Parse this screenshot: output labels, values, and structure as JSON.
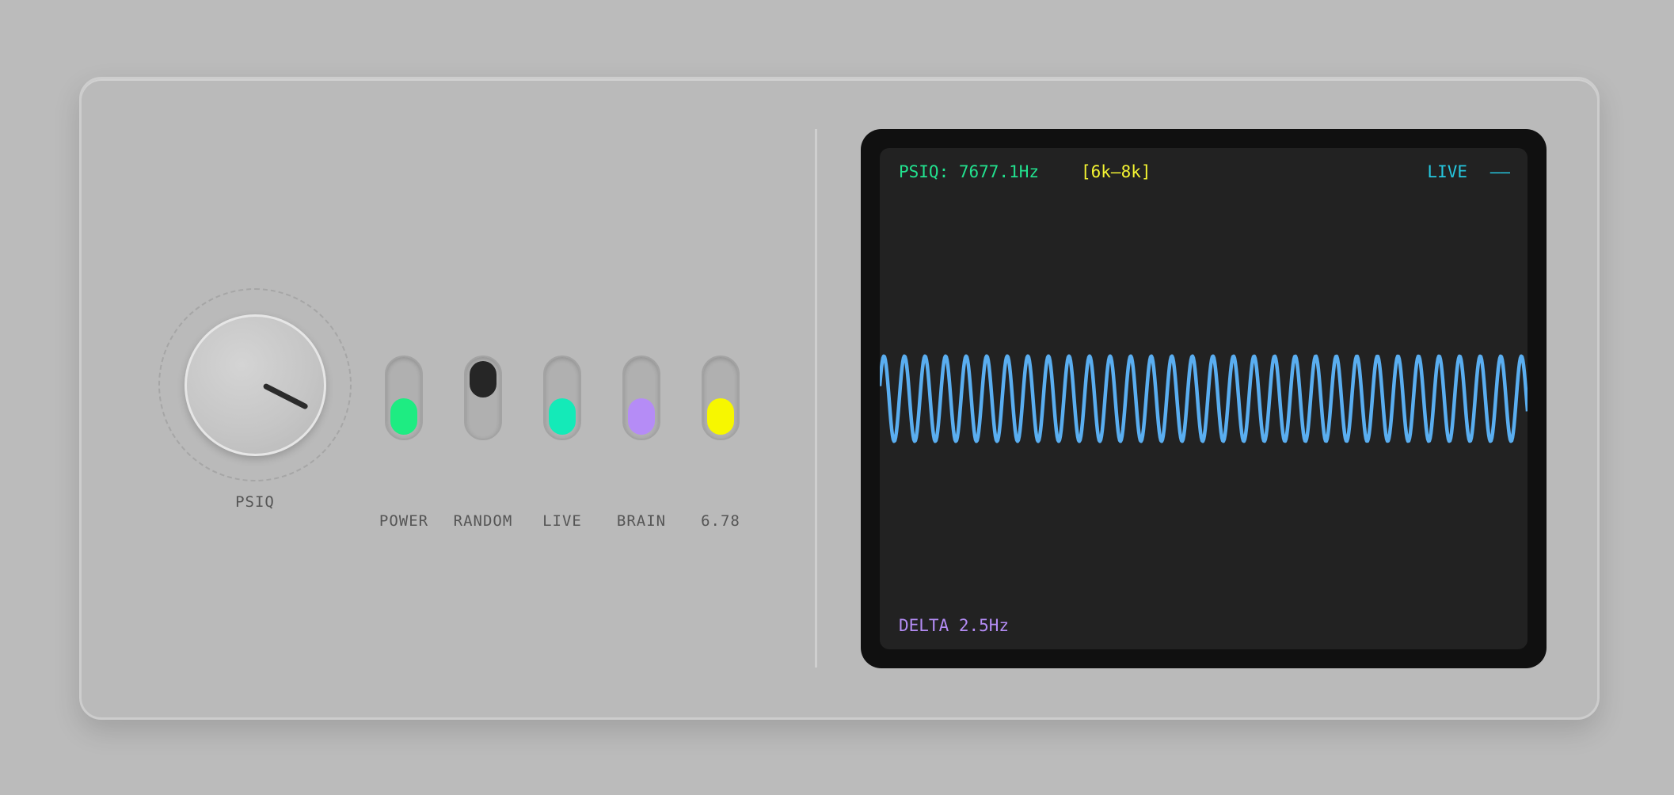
{
  "knob": {
    "label": "PSIQ",
    "value_fraction": 0.62
  },
  "switches": [
    {
      "label": "POWER",
      "state": "on",
      "color": "#1eec82"
    },
    {
      "label": "RANDOM",
      "state": "off",
      "color": "#262626"
    },
    {
      "label": "LIVE",
      "state": "on",
      "color": "#14eab8"
    },
    {
      "label": "BRAIN",
      "state": "on",
      "color": "#b58cf6"
    },
    {
      "label": "6.78",
      "state": "on",
      "color": "#f7f700"
    }
  ],
  "screen": {
    "frequency_text": "PSIQ: 7677.1Hz",
    "range_text": "[6k–8k]",
    "live_text": "LIVE",
    "live_indicator": "––",
    "delta_text": "DELTA 2.5Hz",
    "colors": {
      "frequency": "#22e28f",
      "range": "#f5f532",
      "live": "#25c7df",
      "delta": "#b48cf5",
      "wave": "#5aaef0"
    },
    "waveform": {
      "cycles": 31.5,
      "amplitude_fraction": 0.085
    }
  }
}
